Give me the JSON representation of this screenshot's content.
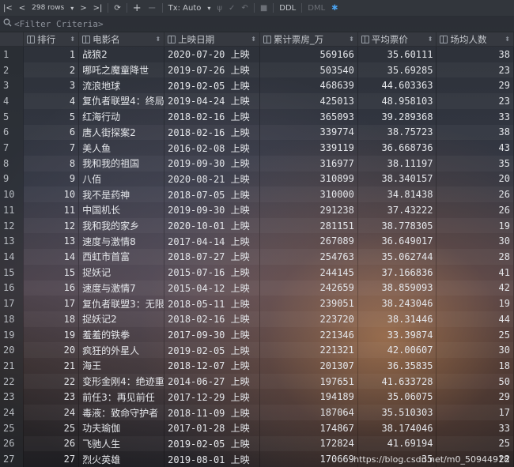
{
  "toolbar": {
    "rows_label": "298 rows",
    "tx_label": "Tx: Auto",
    "ddl_label": "DDL",
    "dml_label": "DML"
  },
  "filter": {
    "placeholder": "<Filter Criteria>"
  },
  "table": {
    "columns": [
      "排行",
      "电影名",
      "上映日期",
      "累计票房_万",
      "平均票价",
      "场均人数"
    ],
    "rows": [
      [
        "1",
        "1",
        "战狼2",
        "2020-07-20 上映",
        "569166",
        "35.60111",
        "38"
      ],
      [
        "2",
        "2",
        "哪吒之魔童降世",
        "2019-07-26 上映",
        "503540",
        "35.69285",
        "23"
      ],
      [
        "3",
        "3",
        "流浪地球",
        "2019-02-05 上映",
        "468639",
        "44.603363",
        "29"
      ],
      [
        "4",
        "4",
        "复仇者联盟4：终局",
        "2019-04-24 上映",
        "425013",
        "48.958103",
        "23"
      ],
      [
        "5",
        "5",
        "红海行动",
        "2018-02-16 上映",
        "365093",
        "39.289368",
        "33"
      ],
      [
        "6",
        "6",
        "唐人街探案2",
        "2018-02-16 上映",
        "339774",
        "38.75723",
        "38"
      ],
      [
        "7",
        "7",
        "美人鱼",
        "2016-02-08 上映",
        "339119",
        "36.668736",
        "43"
      ],
      [
        "8",
        "8",
        "我和我的祖国",
        "2019-09-30 上映",
        "316977",
        "38.11197",
        "35"
      ],
      [
        "9",
        "9",
        "八佰",
        "2020-08-21 上映",
        "310899",
        "38.340157",
        "20"
      ],
      [
        "10",
        "10",
        "我不是药神",
        "2018-07-05 上映",
        "310000",
        "34.81438",
        "26"
      ],
      [
        "11",
        "11",
        "中国机长",
        "2019-09-30 上映",
        "291238",
        "37.43222",
        "26"
      ],
      [
        "12",
        "12",
        "我和我的家乡",
        "2020-10-01 上映",
        "281151",
        "38.778305",
        "19"
      ],
      [
        "13",
        "13",
        "速度与激情8",
        "2017-04-14 上映",
        "267089",
        "36.649017",
        "30"
      ],
      [
        "14",
        "14",
        "西虹市首富",
        "2018-07-27 上映",
        "254763",
        "35.062744",
        "28"
      ],
      [
        "15",
        "15",
        "捉妖记",
        "2015-07-16 上映",
        "244145",
        "37.166836",
        "41"
      ],
      [
        "16",
        "16",
        "速度与激情7",
        "2015-04-12 上映",
        "242659",
        "38.859093",
        "42"
      ],
      [
        "17",
        "17",
        "复仇者联盟3：无限",
        "2018-05-11 上映",
        "239051",
        "38.243046",
        "19"
      ],
      [
        "18",
        "18",
        "捉妖记2",
        "2018-02-16 上映",
        "223720",
        "38.31446",
        "44"
      ],
      [
        "19",
        "19",
        "羞羞的铁拳",
        "2017-09-30 上映",
        "221346",
        "33.39874",
        "25"
      ],
      [
        "20",
        "20",
        "疯狂的外星人",
        "2019-02-05 上映",
        "221321",
        "42.00607",
        "30"
      ],
      [
        "21",
        "21",
        "海王",
        "2018-12-07 上映",
        "201307",
        "36.35835",
        "18"
      ],
      [
        "22",
        "22",
        "变形金刚4：绝迹重",
        "2014-06-27 上映",
        "197651",
        "41.633728",
        "50"
      ],
      [
        "23",
        "23",
        "前任3：再见前任",
        "2017-12-29 上映",
        "194189",
        "35.06075",
        "29"
      ],
      [
        "24",
        "24",
        "毒液：致命守护者",
        "2018-11-09 上映",
        "187064",
        "35.510303",
        "17"
      ],
      [
        "25",
        "25",
        "功夫瑜伽",
        "2017-01-28 上映",
        "174867",
        "38.174046",
        "33"
      ],
      [
        "26",
        "26",
        "飞驰人生",
        "2019-02-05 上映",
        "172824",
        "41.69194",
        "25"
      ],
      [
        "27",
        "27",
        "烈火英雄",
        "2019-08-01 上映",
        "170669",
        "35",
        "22"
      ]
    ]
  },
  "watermark": "https://blog.csdn.net/m0_50944918"
}
